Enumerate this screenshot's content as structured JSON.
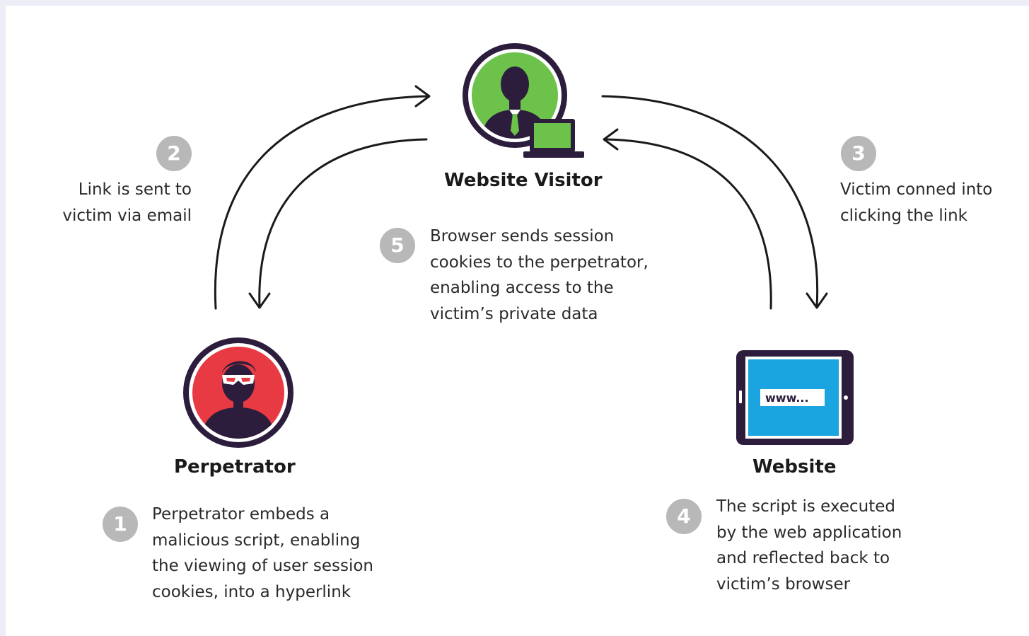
{
  "actors": {
    "visitor": {
      "label": "Website Visitor",
      "icon": "website-visitor-icon",
      "color": "#6cc24a"
    },
    "perpetrator": {
      "label": "Perpetrator",
      "icon": "perpetrator-icon",
      "color": "#e83a43"
    },
    "website": {
      "label": "Website",
      "icon": "website-tablet-icon",
      "color": "#1aa5e0",
      "screen_text": "www..."
    }
  },
  "steps": [
    {
      "number": "1",
      "lines": [
        "Perpetrator embeds a",
        "malicious script, enabling",
        "the viewing of user session",
        "cookies, into a hyperlink"
      ]
    },
    {
      "number": "2",
      "lines": [
        "Link is sent to",
        "victim via email"
      ]
    },
    {
      "number": "3",
      "lines": [
        "Victim conned into",
        "clicking the link"
      ]
    },
    {
      "number": "4",
      "lines": [
        "The script is executed",
        "by the web application",
        "and reflected back to",
        "victim’s browser"
      ]
    },
    {
      "number": "5",
      "lines": [
        "Browser sends session",
        "cookies to the perpetrator,",
        "enabling access to the",
        "victim’s private data"
      ]
    }
  ],
  "colors": {
    "outline": "#2d1d3d",
    "badge": "#b8b8b8",
    "arrow": "#1a1a1a"
  }
}
